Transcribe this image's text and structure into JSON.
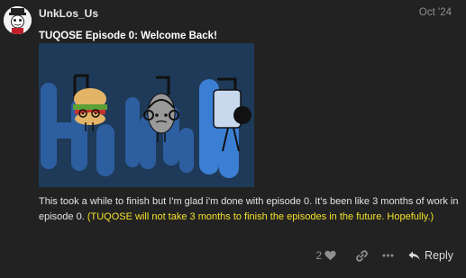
{
  "post": {
    "username": "UnkLos_Us",
    "date": "Oct '24",
    "title": "TUQOSE Episode 0: Welcome Back!",
    "body_text": "This took a while to finish but I'm glad i'm done with episode 0. It's been like 3 months of work in episode 0.",
    "body_highlight": "(TUQOSE will not take 3 months to finish the episodes in the future. Hopefully.)",
    "image_description": "",
    "highlight_color": "#f4e22a"
  },
  "actions": {
    "like_count": "2",
    "like_icon": "heart-icon",
    "link_icon": "link-icon",
    "more_icon": "ellipsis-icon",
    "reply_icon": "reply-arrow-icon",
    "reply_label": "Reply"
  }
}
